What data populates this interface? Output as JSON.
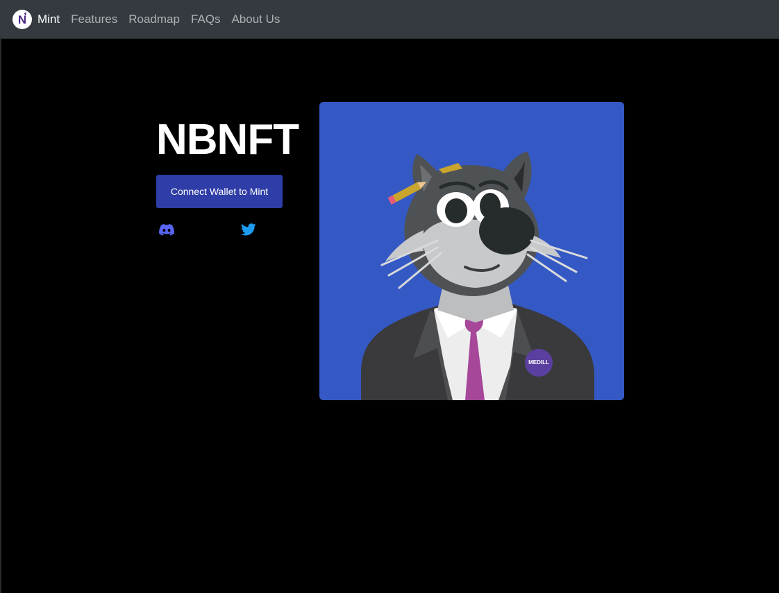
{
  "navbar": {
    "brand": {
      "label": "Mint",
      "logo_icon": "nbnft-logo-icon",
      "logo_letter": "N"
    },
    "links": [
      {
        "label": "Features"
      },
      {
        "label": "Roadmap"
      },
      {
        "label": "FAQs"
      },
      {
        "label": "About Us"
      }
    ]
  },
  "hero": {
    "title": "NBNFT",
    "connect_button": "Connect Wallet to Mint",
    "social_icons": [
      "discord-icon",
      "twitter-icon"
    ]
  },
  "nft_image": {
    "badge_text": "MEDILL",
    "background_color": "#3559c4"
  },
  "colors": {
    "navbar_bg": "#343a40",
    "page_bg": "#000000",
    "button_bg": "#2e3da7",
    "discord": "#5865f2",
    "twitter": "#1d9bf0",
    "tie": "#a6479a"
  }
}
